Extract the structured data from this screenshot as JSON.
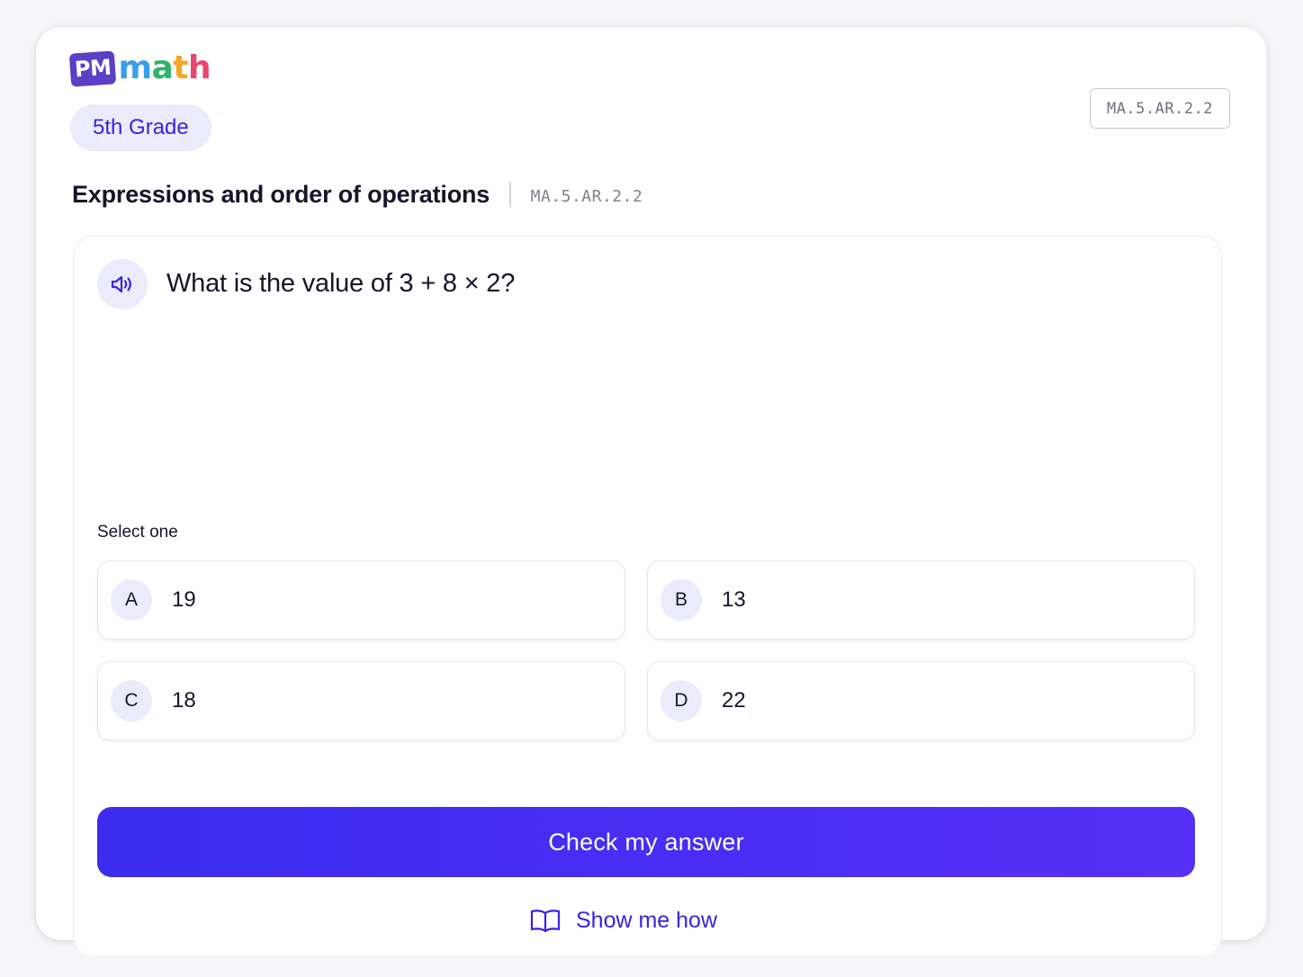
{
  "brand": {
    "logo_badge": "PM",
    "logo_letters": [
      {
        "char": "m",
        "color": "#3a9fe8"
      },
      {
        "char": "a",
        "color": "#2fb26b"
      },
      {
        "char": "t",
        "color": "#f5a623"
      },
      {
        "char": "h",
        "color": "#e6486e"
      }
    ],
    "badge_color": "#5b3fc4"
  },
  "header": {
    "grade_label": "5th Grade",
    "standard_code": "MA.5.AR.2.2"
  },
  "topic": {
    "title": "Expressions and order of operations",
    "code": "MA.5.AR.2.2"
  },
  "question": {
    "audio_icon": "speaker-icon",
    "text": "What is the value of 3 + 8 × 2?"
  },
  "answers": {
    "prompt": "Select one",
    "choices": [
      {
        "letter": "A",
        "value": "19"
      },
      {
        "letter": "B",
        "value": "13"
      },
      {
        "letter": "C",
        "value": "18"
      },
      {
        "letter": "D",
        "value": "22"
      }
    ]
  },
  "actions": {
    "check_label": "Check my answer",
    "show_how_label": "Show me how",
    "show_how_icon": "book-icon"
  },
  "colors": {
    "accent": "#3a22e0",
    "accent_soft": "#ecebfc",
    "button": "#4b2df4"
  }
}
